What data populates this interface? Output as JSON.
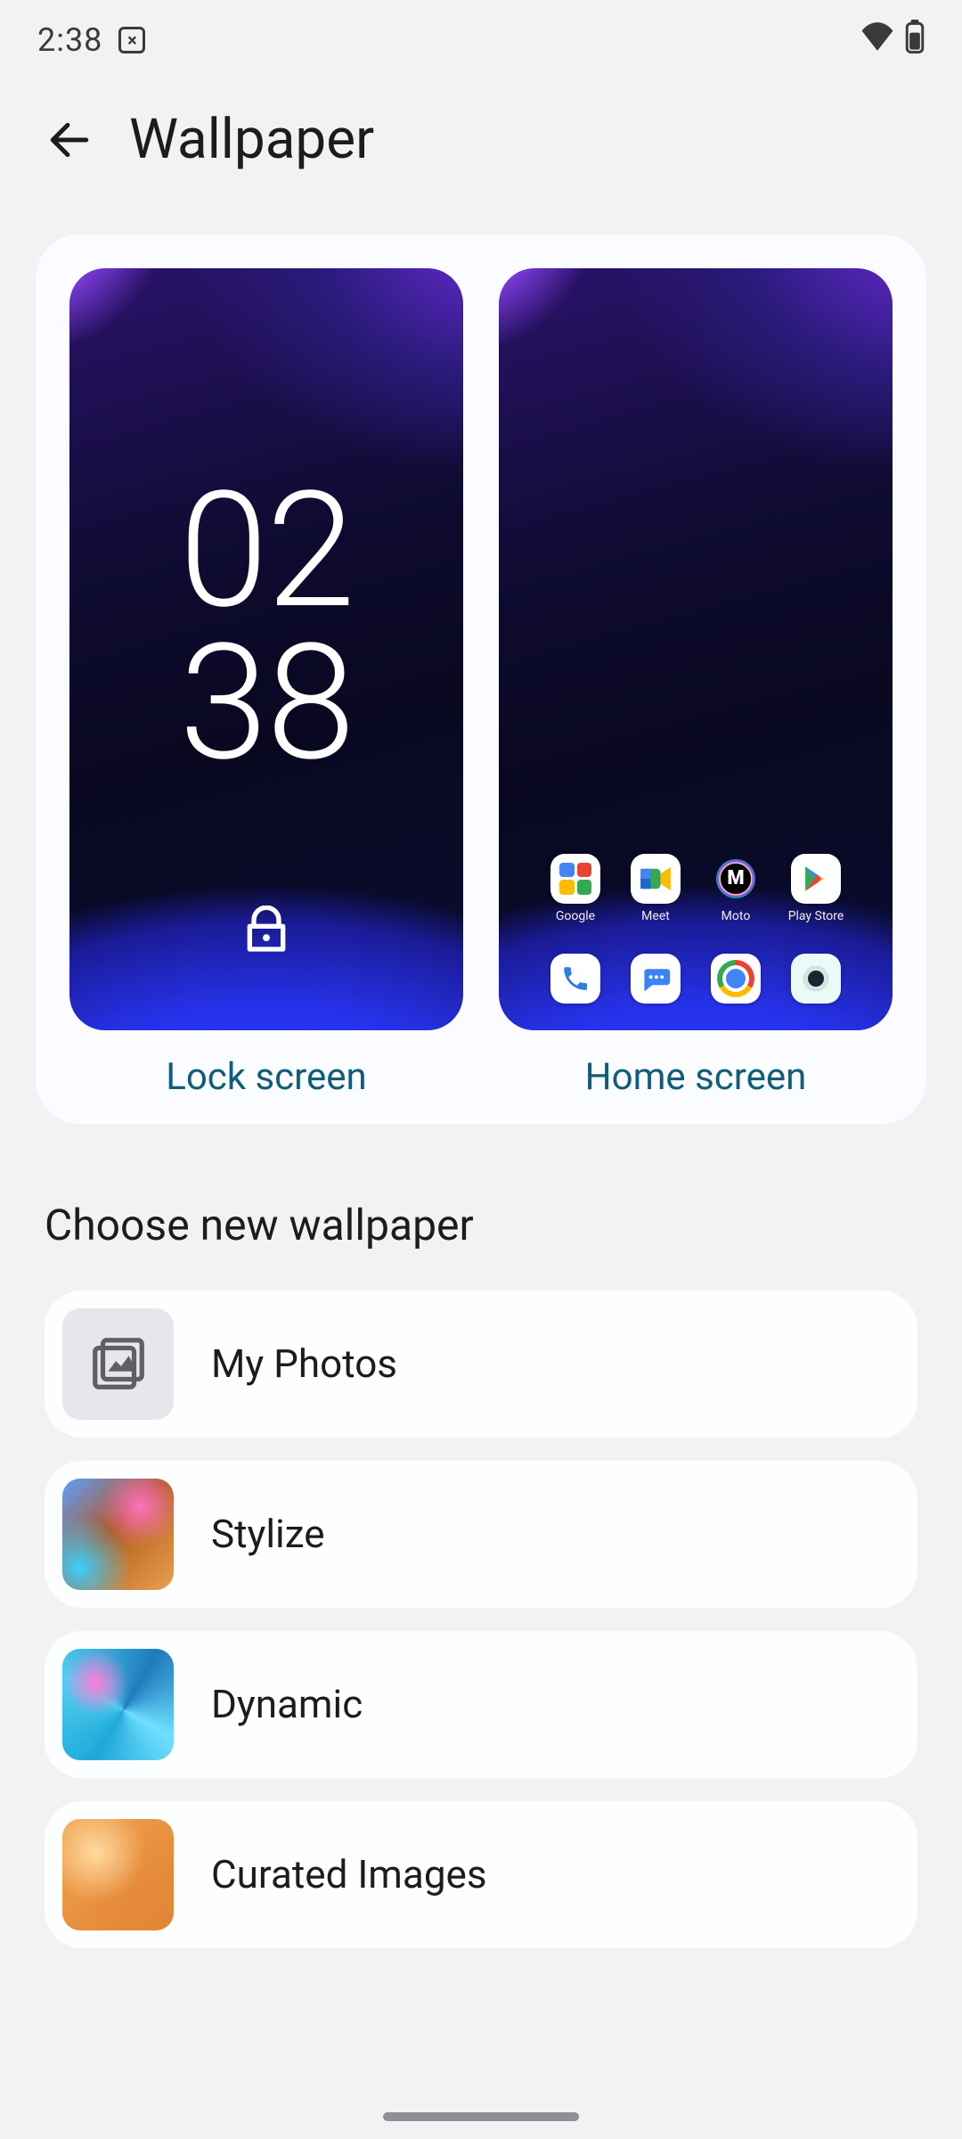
{
  "status": {
    "time": "2:38"
  },
  "header": {
    "title": "Wallpaper"
  },
  "preview": {
    "lock": {
      "hour": "02",
      "minute": "38",
      "caption": "Lock screen"
    },
    "home": {
      "caption": "Home screen",
      "apps_row1": [
        {
          "label": "Google"
        },
        {
          "label": "Meet"
        },
        {
          "label": "Moto"
        },
        {
          "label": "Play Store"
        }
      ]
    }
  },
  "section_title": "Choose new wallpaper",
  "categories": [
    {
      "label": "My Photos"
    },
    {
      "label": "Stylize"
    },
    {
      "label": "Dynamic"
    },
    {
      "label": "Curated Images"
    }
  ]
}
